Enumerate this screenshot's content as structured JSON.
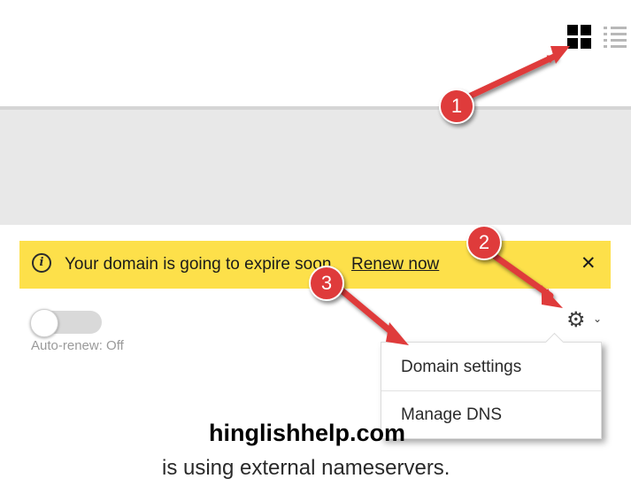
{
  "toolbar": {
    "grid_view_icon": "grid-view-icon",
    "list_view_icon": "list-view-icon"
  },
  "banner": {
    "message": "Your domain is going to expire soon.",
    "link_text": "Renew now",
    "close_symbol": "✕",
    "info_symbol": "i",
    "background_color": "#fde04a"
  },
  "auto_renew": {
    "label": "Auto-renew: Off",
    "enabled": false
  },
  "settings_menu": {
    "gear_symbol": "⚙",
    "chevron_symbol": "⌄",
    "items": [
      {
        "label": "Domain settings"
      },
      {
        "label": "Manage DNS"
      }
    ]
  },
  "domain": {
    "name": "hinglishhelp.com",
    "status_text": "is using external nameservers."
  },
  "annotations": {
    "badges": [
      "1",
      "2",
      "3"
    ],
    "color": "#df3b3b"
  }
}
